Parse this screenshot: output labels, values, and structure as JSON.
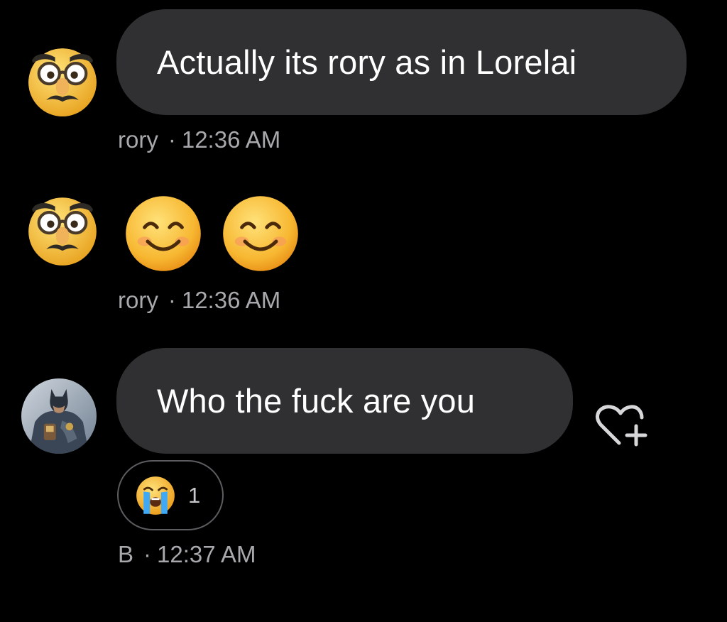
{
  "messages": [
    {
      "sender": "rory",
      "avatar_icon": "disguise-glasses-emoji",
      "text": "Actually its rory as in Lorelai",
      "separator": "·",
      "time": "12:36 AM"
    },
    {
      "sender": "rory",
      "avatar_icon": "disguise-glasses-emoji",
      "emojis": [
        "smiling-face-with-smiling-eyes",
        "smiling-face-with-smiling-eyes"
      ],
      "separator": "·",
      "time": "12:36 AM"
    },
    {
      "sender": "B",
      "avatar_icon": "batman-avatar",
      "text": "Who the fuck are you",
      "separator": "·",
      "time": "12:37 AM",
      "reaction": {
        "emoji": "loudly-crying-face",
        "count": "1"
      },
      "react_button_icon": "heart-plus-icon"
    }
  ],
  "colors": {
    "background": "#000000",
    "bubble": "#303033",
    "meta_text": "#a8a8ad",
    "reaction_border": "#5d5d61"
  }
}
